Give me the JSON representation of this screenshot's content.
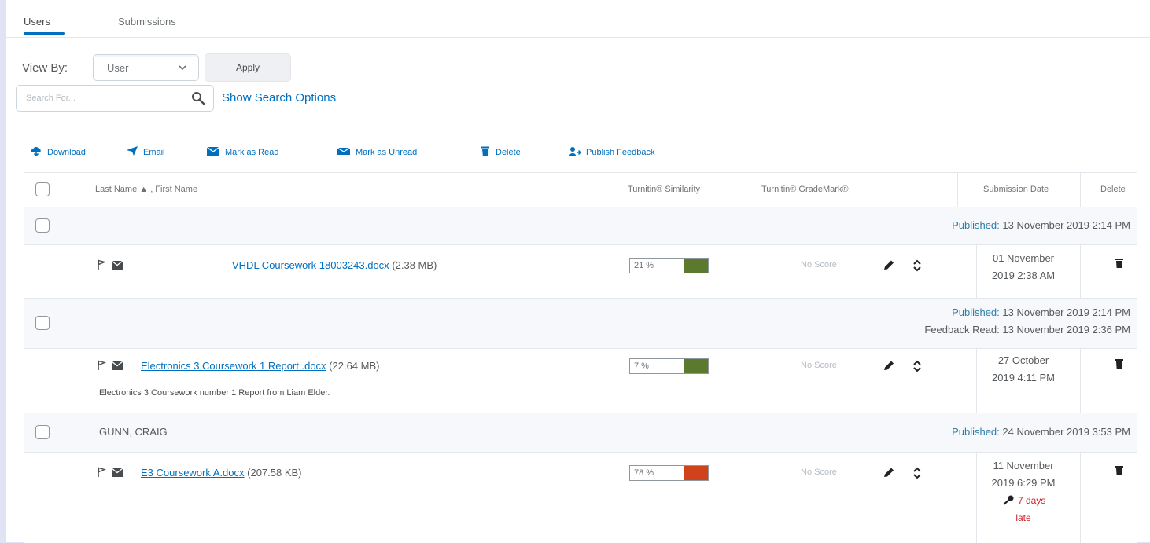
{
  "tabs": [
    {
      "label": "Users",
      "active": true
    },
    {
      "label": "Submissions",
      "active": false
    }
  ],
  "view_by": {
    "label": "View By:",
    "selected": "User",
    "apply_label": "Apply"
  },
  "search": {
    "placeholder": "Search For...",
    "show_options_label": "Show Search Options"
  },
  "toolbar": {
    "download": "Download",
    "email": "Email",
    "mark_read": "Mark as Read",
    "mark_unread": "Mark as Unread",
    "delete": "Delete",
    "publish_feedback": "Publish Feedback"
  },
  "table": {
    "headers": {
      "name": "Last Name ▲ , First Name",
      "similarity": "Turnitin® Similarity",
      "grademark": "Turnitin® GradeMark®",
      "date": "Submission Date",
      "delete": "Delete"
    },
    "groups": [
      {
        "student": "",
        "published_label": "Published:",
        "published_value": " 13 November 2019 2:14 PM",
        "feedback_label": "",
        "feedback_value": "",
        "file": {
          "name": "VHDL Coursework 18003243.docx",
          "size": "(2.38 MB)"
        },
        "comment": "",
        "similarity": {
          "text": "21 %",
          "percent": 21,
          "color": "#5b7a2d"
        },
        "score": "No Score",
        "date_line1": "01 November",
        "date_line2": "2019 2:38 AM",
        "late": ""
      },
      {
        "student": "",
        "published_label": "Published:",
        "published_value": " 13 November 2019 2:14 PM",
        "feedback_label": "Feedback Read:",
        "feedback_value": " 13 November 2019 2:36 PM",
        "file": {
          "name": "Electronics 3 Coursework 1 Report .docx",
          "size": "(22.64 MB)"
        },
        "comment": "Electronics 3 Coursework number 1 Report from Liam Elder.",
        "similarity": {
          "text": "7 %",
          "percent": 7,
          "color": "#5b7a2d"
        },
        "score": "No Score",
        "date_line1": "27 October",
        "date_line2": "2019 4:11 PM",
        "late": ""
      },
      {
        "student": "GUNN, CRAIG",
        "published_label": "Published:",
        "published_value": " 24 November 2019 3:53 PM",
        "feedback_label": "",
        "feedback_value": "",
        "file": {
          "name": "E3 Coursework A.docx",
          "size": "(207.58 KB)"
        },
        "comment": "",
        "similarity": {
          "text": "78 %",
          "percent": 78,
          "color": "#d0421b"
        },
        "score": "No Score",
        "date_line1": "11 November",
        "date_line2": "2019 6:29 PM",
        "late_line1": "7 days",
        "late_line2": "late"
      }
    ]
  },
  "colors": {
    "link": "#006fbf",
    "published_label": "#2d7ea8",
    "late": "#cd2026"
  }
}
